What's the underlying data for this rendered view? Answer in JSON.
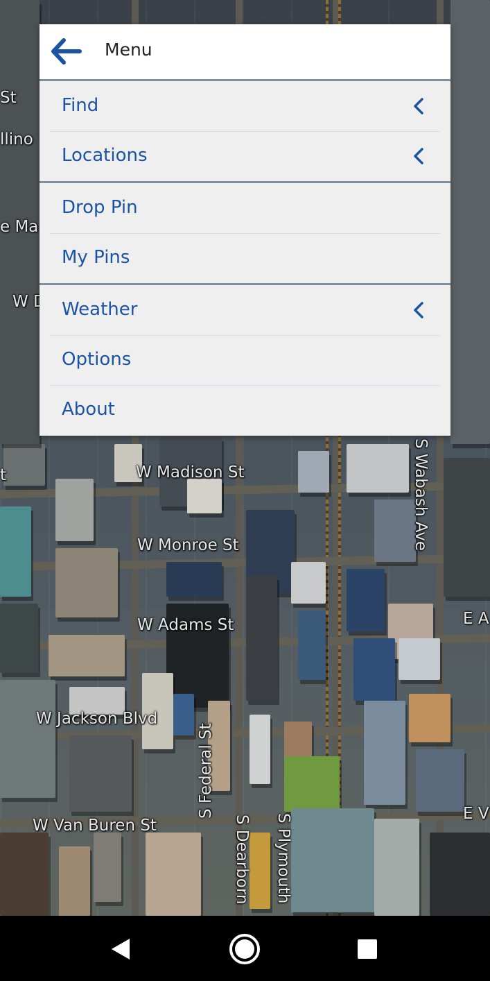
{
  "menu": {
    "title": "Menu",
    "groups": [
      {
        "items": [
          {
            "label": "Find",
            "submenu": true
          },
          {
            "label": "Locations",
            "submenu": true
          }
        ]
      },
      {
        "items": [
          {
            "label": "Drop Pin"
          },
          {
            "label": "My Pins"
          }
        ]
      },
      {
        "items": [
          {
            "label": "Weather",
            "submenu": true
          },
          {
            "label": "Options"
          },
          {
            "label": "About"
          }
        ]
      }
    ]
  },
  "map": {
    "streets": [
      "St",
      "llino",
      "e Ma",
      "W D",
      "t",
      "W Madison St",
      "W Monroe St",
      "W Adams St",
      "W Jackson Blvd",
      "W Van Buren St",
      "S Wabash Ave",
      "S Federal St",
      "S Dearborn",
      "S Plymouth",
      "E A",
      "E V"
    ]
  },
  "nav": {
    "back_icon": "triangle-back-icon",
    "home_icon": "circle-home-icon",
    "recents_icon": "square-recents-icon"
  },
  "colors": {
    "accent": "#1c54a4",
    "divider": "#7d8fa5",
    "menu_bg": "#efefef"
  }
}
